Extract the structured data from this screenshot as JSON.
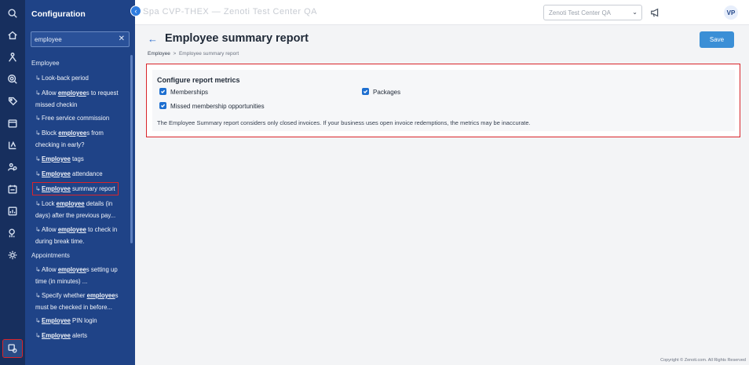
{
  "topbar": {
    "app_title": "Spa CVP-THEX — Zenoti Test Center QA",
    "center_select": "Zenoti Test Center QA",
    "avatar_initials": "VP"
  },
  "config_panel": {
    "title": "Configuration",
    "search_value": "employee",
    "sections": [
      {
        "label": "Employee",
        "items": [
          {
            "label": "Look-back period"
          },
          {
            "label": "Allow employees to request missed checkin"
          },
          {
            "label": "Free service commission"
          },
          {
            "label": "Block employees from checking in early?"
          },
          {
            "label": "Employee tags"
          },
          {
            "label": "Employee attendance"
          },
          {
            "label": "Employee summary report"
          },
          {
            "label": "Lock employee details (in days) after the previous pay..."
          },
          {
            "label": "Allow employee to check in during break time."
          }
        ]
      },
      {
        "label": "Appointments",
        "items": [
          {
            "label": "Allow employees setting up time (in minutes) ..."
          },
          {
            "label": "Specify whether employees must be checked in before..."
          },
          {
            "label": "Employee PIN login"
          },
          {
            "label": "Employee alerts"
          }
        ]
      }
    ]
  },
  "main": {
    "page_title": "Employee summary report",
    "breadcrumb": {
      "parent": "Employee",
      "separator": ">",
      "current": "Employee summary report"
    },
    "save_label": "Save",
    "card": {
      "title": "Configure report metrics",
      "options": [
        {
          "label": "Memberships",
          "checked": true
        },
        {
          "label": "Packages",
          "checked": true
        },
        {
          "label": "Missed membership opportunities",
          "checked": true
        }
      ],
      "note": "The Employee Summary report considers only closed invoices. If your business uses open invoice redemptions, the metrics may be inaccurate."
    }
  },
  "footer": {
    "copyright": "Copyright © Zenoti.com. All Rights Reserved"
  },
  "colors": {
    "rail": "#172f5e",
    "panel": "#1f4387",
    "accent": "#3b8fd6",
    "highlight": "#d9242a"
  },
  "rail_icons": [
    "search-icon",
    "home-icon",
    "people-icon",
    "marketing-icon",
    "tag-icon",
    "calendar-icon",
    "catalog-icon",
    "employee-icon",
    "schedule-icon",
    "reports-icon",
    "analytics-icon",
    "settings-gear-icon",
    "config-icon"
  ]
}
